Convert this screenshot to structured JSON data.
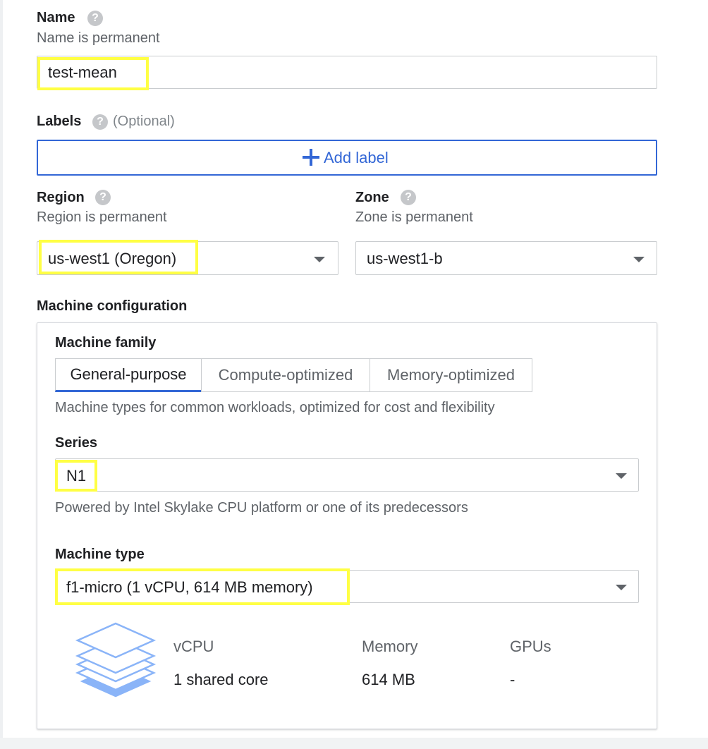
{
  "name": {
    "label": "Name",
    "help": "?",
    "sublabel": "Name is permanent",
    "value": "test-mean"
  },
  "labels": {
    "label": "Labels",
    "help": "?",
    "optional": "(Optional)",
    "add_icon": "+",
    "add_label": "Add label"
  },
  "region": {
    "label": "Region",
    "help": "?",
    "sublabel": "Region is permanent",
    "value": "us-west1 (Oregon)"
  },
  "zone": {
    "label": "Zone",
    "help": "?",
    "sublabel": "Zone is permanent",
    "value": "us-west1-b"
  },
  "machine_config": {
    "heading": "Machine configuration",
    "family_label": "Machine family",
    "tabs": [
      {
        "label": "General-purpose",
        "active": true
      },
      {
        "label": "Compute-optimized",
        "active": false
      },
      {
        "label": "Memory-optimized",
        "active": false
      }
    ],
    "family_desc": "Machine types for common workloads, optimized for cost and flexibility",
    "series_label": "Series",
    "series_value": "N1",
    "series_desc": "Powered by Intel Skylake CPU platform or one of its predecessors",
    "type_label": "Machine type",
    "type_value": "f1-micro (1 vCPU, 614 MB memory)",
    "specs": {
      "vcpu_head": "vCPU",
      "vcpu_value": "1 shared core",
      "memory_head": "Memory",
      "memory_value": "614 MB",
      "gpus_head": "GPUs",
      "gpus_value": "-"
    }
  },
  "icons": {
    "help": "help-circle-icon",
    "caret": "dropdown-caret-icon",
    "add": "plus-icon",
    "machine": "stacked-layers-icon"
  },
  "colors": {
    "highlight": "#ffff44",
    "accent": "#3367d6",
    "icon_light": "#8ab4f8"
  }
}
